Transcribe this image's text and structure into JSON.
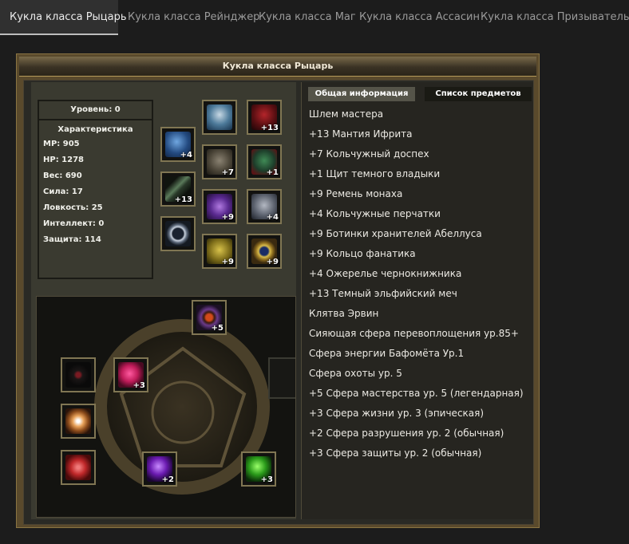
{
  "tabs": [
    {
      "label": "Кукла класса Рыцарь",
      "active": true
    },
    {
      "label": "Кукла класса Рейнджер",
      "active": false
    },
    {
      "label": "Кукла класса Маг",
      "active": false
    },
    {
      "label": "Кукла класса Ассасин",
      "active": false
    },
    {
      "label": "Кукла класса Призыватель",
      "active": false
    }
  ],
  "panel": {
    "title": "Кукла класса Рыцарь",
    "level": "Уровень: 0",
    "stats_header": "Характеристика",
    "stats": [
      "MP: 905",
      "HP: 1278",
      "Вес: 690",
      "Сила: 17",
      "Ловкость: 25",
      "Интеллект: 0",
      "Защита: 114"
    ]
  },
  "equipment": [
    {
      "icon": "shoulder-armor-icon",
      "enchant": "+4"
    },
    {
      "icon": "sword-icon",
      "enchant": "+13"
    },
    {
      "icon": "ring-icon",
      "enchant": ""
    },
    {
      "icon": "helmet-icon",
      "enchant": ""
    },
    {
      "icon": "cloak-icon",
      "enchant": "+13"
    },
    {
      "icon": "chainmail-icon",
      "enchant": "+7"
    },
    {
      "icon": "shield-icon",
      "enchant": "+1"
    },
    {
      "icon": "belt-icon",
      "enchant": "+9"
    },
    {
      "icon": "gloves-icon",
      "enchant": "+4"
    },
    {
      "icon": "boots-icon",
      "enchant": "+9"
    },
    {
      "icon": "ring-icon",
      "enchant": "+9"
    }
  ],
  "spheres": [
    {
      "icon": "sphere-top-icon",
      "enchant": "+5"
    },
    {
      "icon": "dark-sphere-icon",
      "enchant": ""
    },
    {
      "icon": "pink-sphere-icon",
      "enchant": "+3"
    },
    {
      "icon": "swirl-sphere-icon",
      "enchant": ""
    },
    {
      "icon": "red-sphere-icon",
      "enchant": ""
    },
    {
      "icon": "purple-sphere-icon",
      "enchant": "+2"
    },
    {
      "icon": "green-sphere-icon",
      "enchant": "+3"
    },
    {
      "icon": "empty-slot-icon",
      "enchant": ""
    }
  ],
  "info_tabs": [
    {
      "label": "Общая информация",
      "active": true
    },
    {
      "label": "Список предметов",
      "active": false
    }
  ],
  "items": [
    "Шлем мастера",
    "+13 Мантия Ифрита",
    "+7 Кольчужный доспех",
    "+1 Щит темного владыки",
    "+9 Ремень монаха",
    "+4 Кольчужные перчатки",
    "+9 Ботинки хранителей Абеллуса",
    "+9 Кольцо фанатика",
    "+4 Ожерелье чернокнижника",
    "+13 Темный эльфийский меч",
    "Клятва Эрвин",
    "Сияющая сфера перевоплощения ур.85+",
    "Сфера энергии Бафомёта Ур.1",
    "Сфера охоты ур. 5",
    "+5 Сфера мастерства ур. 5 (легендарная)",
    "+3 Сфера жизни ур. 3 (эпическая)",
    "+2 Сфера разрушения ур. 2 (обычная)",
    "+3 Сфера защиты ур. 2 (обычная)"
  ],
  "colors": {
    "accent": "#807653",
    "text": "#eceae4",
    "tab_active": "#ececec",
    "tab_inactive": "#9a9a9a"
  }
}
